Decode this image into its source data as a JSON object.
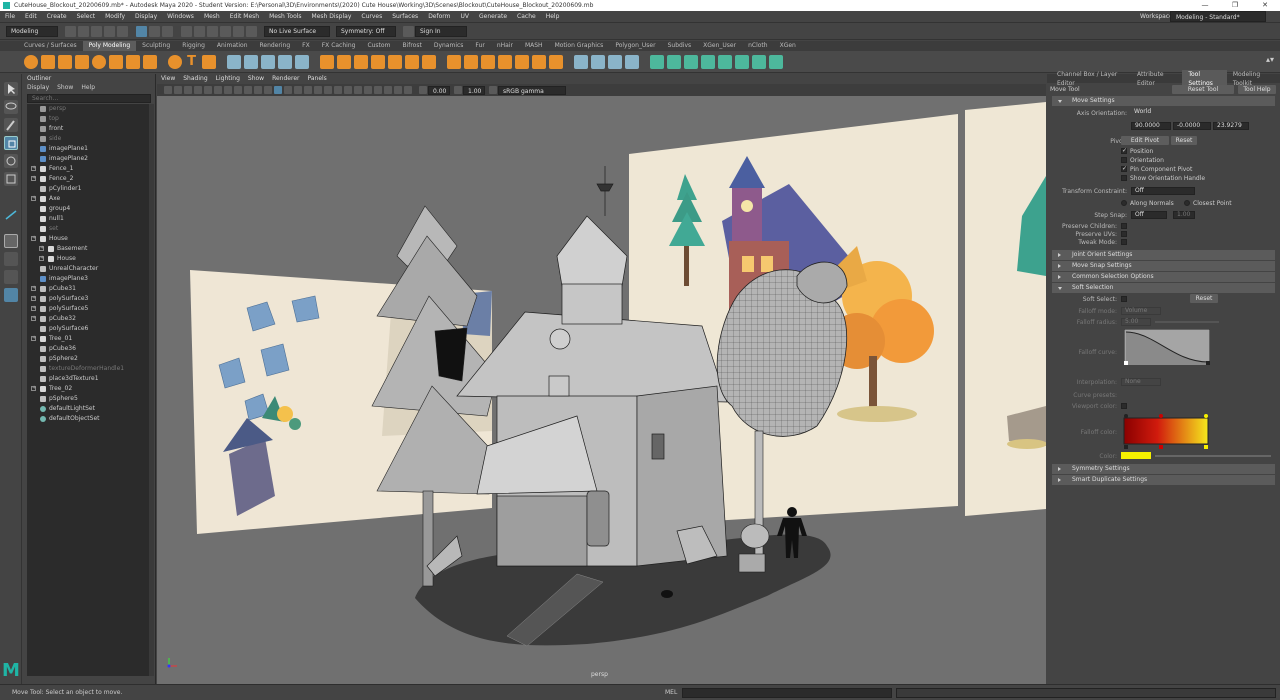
{
  "window": {
    "title": "CuteHouse_Blockout_20200609.mb* - Autodesk Maya 2020 - Student Version: E:\\Personal\\3D\\Environments\\(2020) Cute House\\Working\\3D\\Scenes\\Blockout\\CuteHouse_Blockout_20200609.mb",
    "minimize": "—",
    "maximize": "❐",
    "close": "✕"
  },
  "menubar": [
    "File",
    "Edit",
    "Create",
    "Select",
    "Modify",
    "Display",
    "Windows",
    "Mesh",
    "Edit Mesh",
    "Mesh Tools",
    "Mesh Display",
    "Curves",
    "Surfaces",
    "Deform",
    "UV",
    "Generate",
    "Cache",
    "Help"
  ],
  "workspace": {
    "label": "Workspace :",
    "value": "Modeling - Standard*"
  },
  "statusline": {
    "mode": "Modeling",
    "live_surface": "No Live Surface",
    "symmetry": "Symmetry: Off",
    "signin": "Sign In"
  },
  "shelf_tabs": [
    "Curves / Surfaces",
    "Poly Modeling",
    "Sculpting",
    "Rigging",
    "Animation",
    "Rendering",
    "FX",
    "FX Caching",
    "Custom",
    "Bifrost",
    "Dynamics",
    "Fur",
    "nHair",
    "MASH",
    "Motion Graphics",
    "Polygon_User",
    "Subdivs",
    "XGen_User",
    "nCloth",
    "XGen"
  ],
  "shelf_active": "Poly Modeling",
  "outliner": {
    "title": "Outliner",
    "menu": [
      "Display",
      "Show",
      "Help"
    ],
    "search_placeholder": "Search...",
    "items": [
      {
        "name": "persp",
        "dim": true,
        "indent": 0,
        "icon": "camera"
      },
      {
        "name": "top",
        "dim": true,
        "indent": 0,
        "icon": "camera"
      },
      {
        "name": "front",
        "dim": false,
        "indent": 0,
        "icon": "camera"
      },
      {
        "name": "side",
        "dim": true,
        "indent": 0,
        "icon": "camera"
      },
      {
        "name": "imagePlane1",
        "dim": false,
        "indent": 0,
        "icon": "image"
      },
      {
        "name": "imagePlane2",
        "dim": false,
        "indent": 0,
        "icon": "image"
      },
      {
        "name": "Fence_1",
        "dim": false,
        "indent": 0,
        "icon": "group",
        "expand": true
      },
      {
        "name": "Fence_2",
        "dim": false,
        "indent": 0,
        "icon": "group",
        "expand": true
      },
      {
        "name": "pCylinder1",
        "dim": false,
        "indent": 0,
        "icon": "mesh"
      },
      {
        "name": "Axe",
        "dim": false,
        "indent": 0,
        "icon": "group",
        "expand": true
      },
      {
        "name": "group4",
        "dim": false,
        "indent": 0,
        "icon": "group"
      },
      {
        "name": "null1",
        "dim": false,
        "indent": 0,
        "icon": "group"
      },
      {
        "name": "set",
        "dim": true,
        "indent": 0,
        "icon": "group"
      },
      {
        "name": "House",
        "dim": false,
        "indent": 0,
        "icon": "group",
        "expand": true
      },
      {
        "name": "Basement",
        "dim": false,
        "indent": 1,
        "icon": "group",
        "expand": true
      },
      {
        "name": "House",
        "dim": false,
        "indent": 1,
        "icon": "group",
        "expand": true
      },
      {
        "name": "UnrealCharacter",
        "dim": false,
        "indent": 0,
        "icon": "mesh"
      },
      {
        "name": "imagePlane3",
        "dim": false,
        "indent": 0,
        "icon": "image"
      },
      {
        "name": "pCube31",
        "dim": false,
        "indent": 0,
        "icon": "mesh",
        "expand": true
      },
      {
        "name": "polySurface3",
        "dim": false,
        "indent": 0,
        "icon": "mesh",
        "expand": true
      },
      {
        "name": "polySurface5",
        "dim": false,
        "indent": 0,
        "icon": "mesh",
        "expand": true
      },
      {
        "name": "pCube32",
        "dim": false,
        "indent": 0,
        "icon": "mesh",
        "expand": true
      },
      {
        "name": "polySurface6",
        "dim": false,
        "indent": 0,
        "icon": "mesh"
      },
      {
        "name": "Tree_01",
        "dim": false,
        "indent": 0,
        "icon": "group",
        "expand": true
      },
      {
        "name": "pCube36",
        "dim": false,
        "indent": 0,
        "icon": "mesh"
      },
      {
        "name": "pSphere2",
        "dim": false,
        "indent": 0,
        "icon": "mesh"
      },
      {
        "name": "textureDeformerHandle1",
        "dim": true,
        "indent": 0,
        "icon": "mesh"
      },
      {
        "name": "place3dTexture1",
        "dim": false,
        "indent": 0,
        "icon": "mesh"
      },
      {
        "name": "Tree_02",
        "dim": false,
        "indent": 0,
        "icon": "group",
        "expand": true
      },
      {
        "name": "pSphere5",
        "dim": false,
        "indent": 0,
        "icon": "mesh"
      },
      {
        "name": "defaultLightSet",
        "dim": false,
        "indent": 0,
        "icon": "set"
      },
      {
        "name": "defaultObjectSet",
        "dim": false,
        "indent": 0,
        "icon": "set"
      }
    ]
  },
  "viewport": {
    "menu": [
      "View",
      "Shading",
      "Lighting",
      "Show",
      "Renderer",
      "Panels"
    ],
    "exposure": "0.00",
    "gamma": "1.00",
    "colorspace": "sRGB gamma",
    "camera_label": "persp"
  },
  "attr_tabs": [
    "Channel Box / Layer Editor",
    "Attribute Editor",
    "Tool Settings",
    "Modeling Toolkit"
  ],
  "attr_tab_active": "Tool Settings",
  "tool": {
    "name": "Move Tool",
    "reset_tool": "Reset Tool",
    "tool_help": "Tool Help",
    "move_settings": "Move Settings",
    "axis_orientation_label": "Axis Orientation:",
    "axis_orientation_value": "World",
    "axis_x": "90.0000",
    "axis_y": "-0.0000",
    "axis_z": "23.9279",
    "pivot_label": "Pivot:",
    "edit_pivot": "Edit Pivot",
    "reset": "Reset",
    "pivot_opts": [
      "Position",
      "Orientation",
      "Pin Component Pivot",
      "Show Orientation Handle"
    ],
    "pivot_checked": [
      true,
      false,
      true,
      false
    ],
    "transform_constraint_label": "Transform Constraint:",
    "transform_constraint_value": "Off",
    "along_normals": "Along Normals",
    "closest_point": "Closest Point",
    "step_snap_label": "Step Snap:",
    "step_snap_value": "Off",
    "step_snap_num": "1.00",
    "preserve_children": "Preserve Children:",
    "preserve_uvs": "Preserve UVs:",
    "tweak_mode": "Tweak Mode:",
    "joint_orient": "Joint Orient Settings",
    "move_snap": "Move Snap Settings",
    "common_selection": "Common Selection Options",
    "soft_selection": "Soft Selection",
    "soft_select_label": "Soft Select:",
    "soft_reset": "Reset",
    "falloff_mode_label": "Falloff mode:",
    "falloff_mode_value": "Volume",
    "falloff_radius_label": "Falloff radius:",
    "falloff_radius_value": "5.00",
    "falloff_curve_label": "Falloff curve:",
    "interpolation_label": "Interpolation:",
    "interpolation_value": "None",
    "curve_presets_label": "Curve presets:",
    "viewport_color_label": "Viewport color:",
    "falloff_color_label": "Falloff color:",
    "color_label": "Color:",
    "symmetry_settings": "Symmetry Settings",
    "smart_duplicate": "Smart Duplicate Settings"
  },
  "help": {
    "text": "Move Tool: Select an object to move.",
    "mel": "MEL"
  },
  "colors": {
    "accent_blue": "#5285a6",
    "shelf_orange": "#e8912c",
    "maya_logo": "#1fb5a5",
    "soft_yellow": "#f5f000"
  }
}
